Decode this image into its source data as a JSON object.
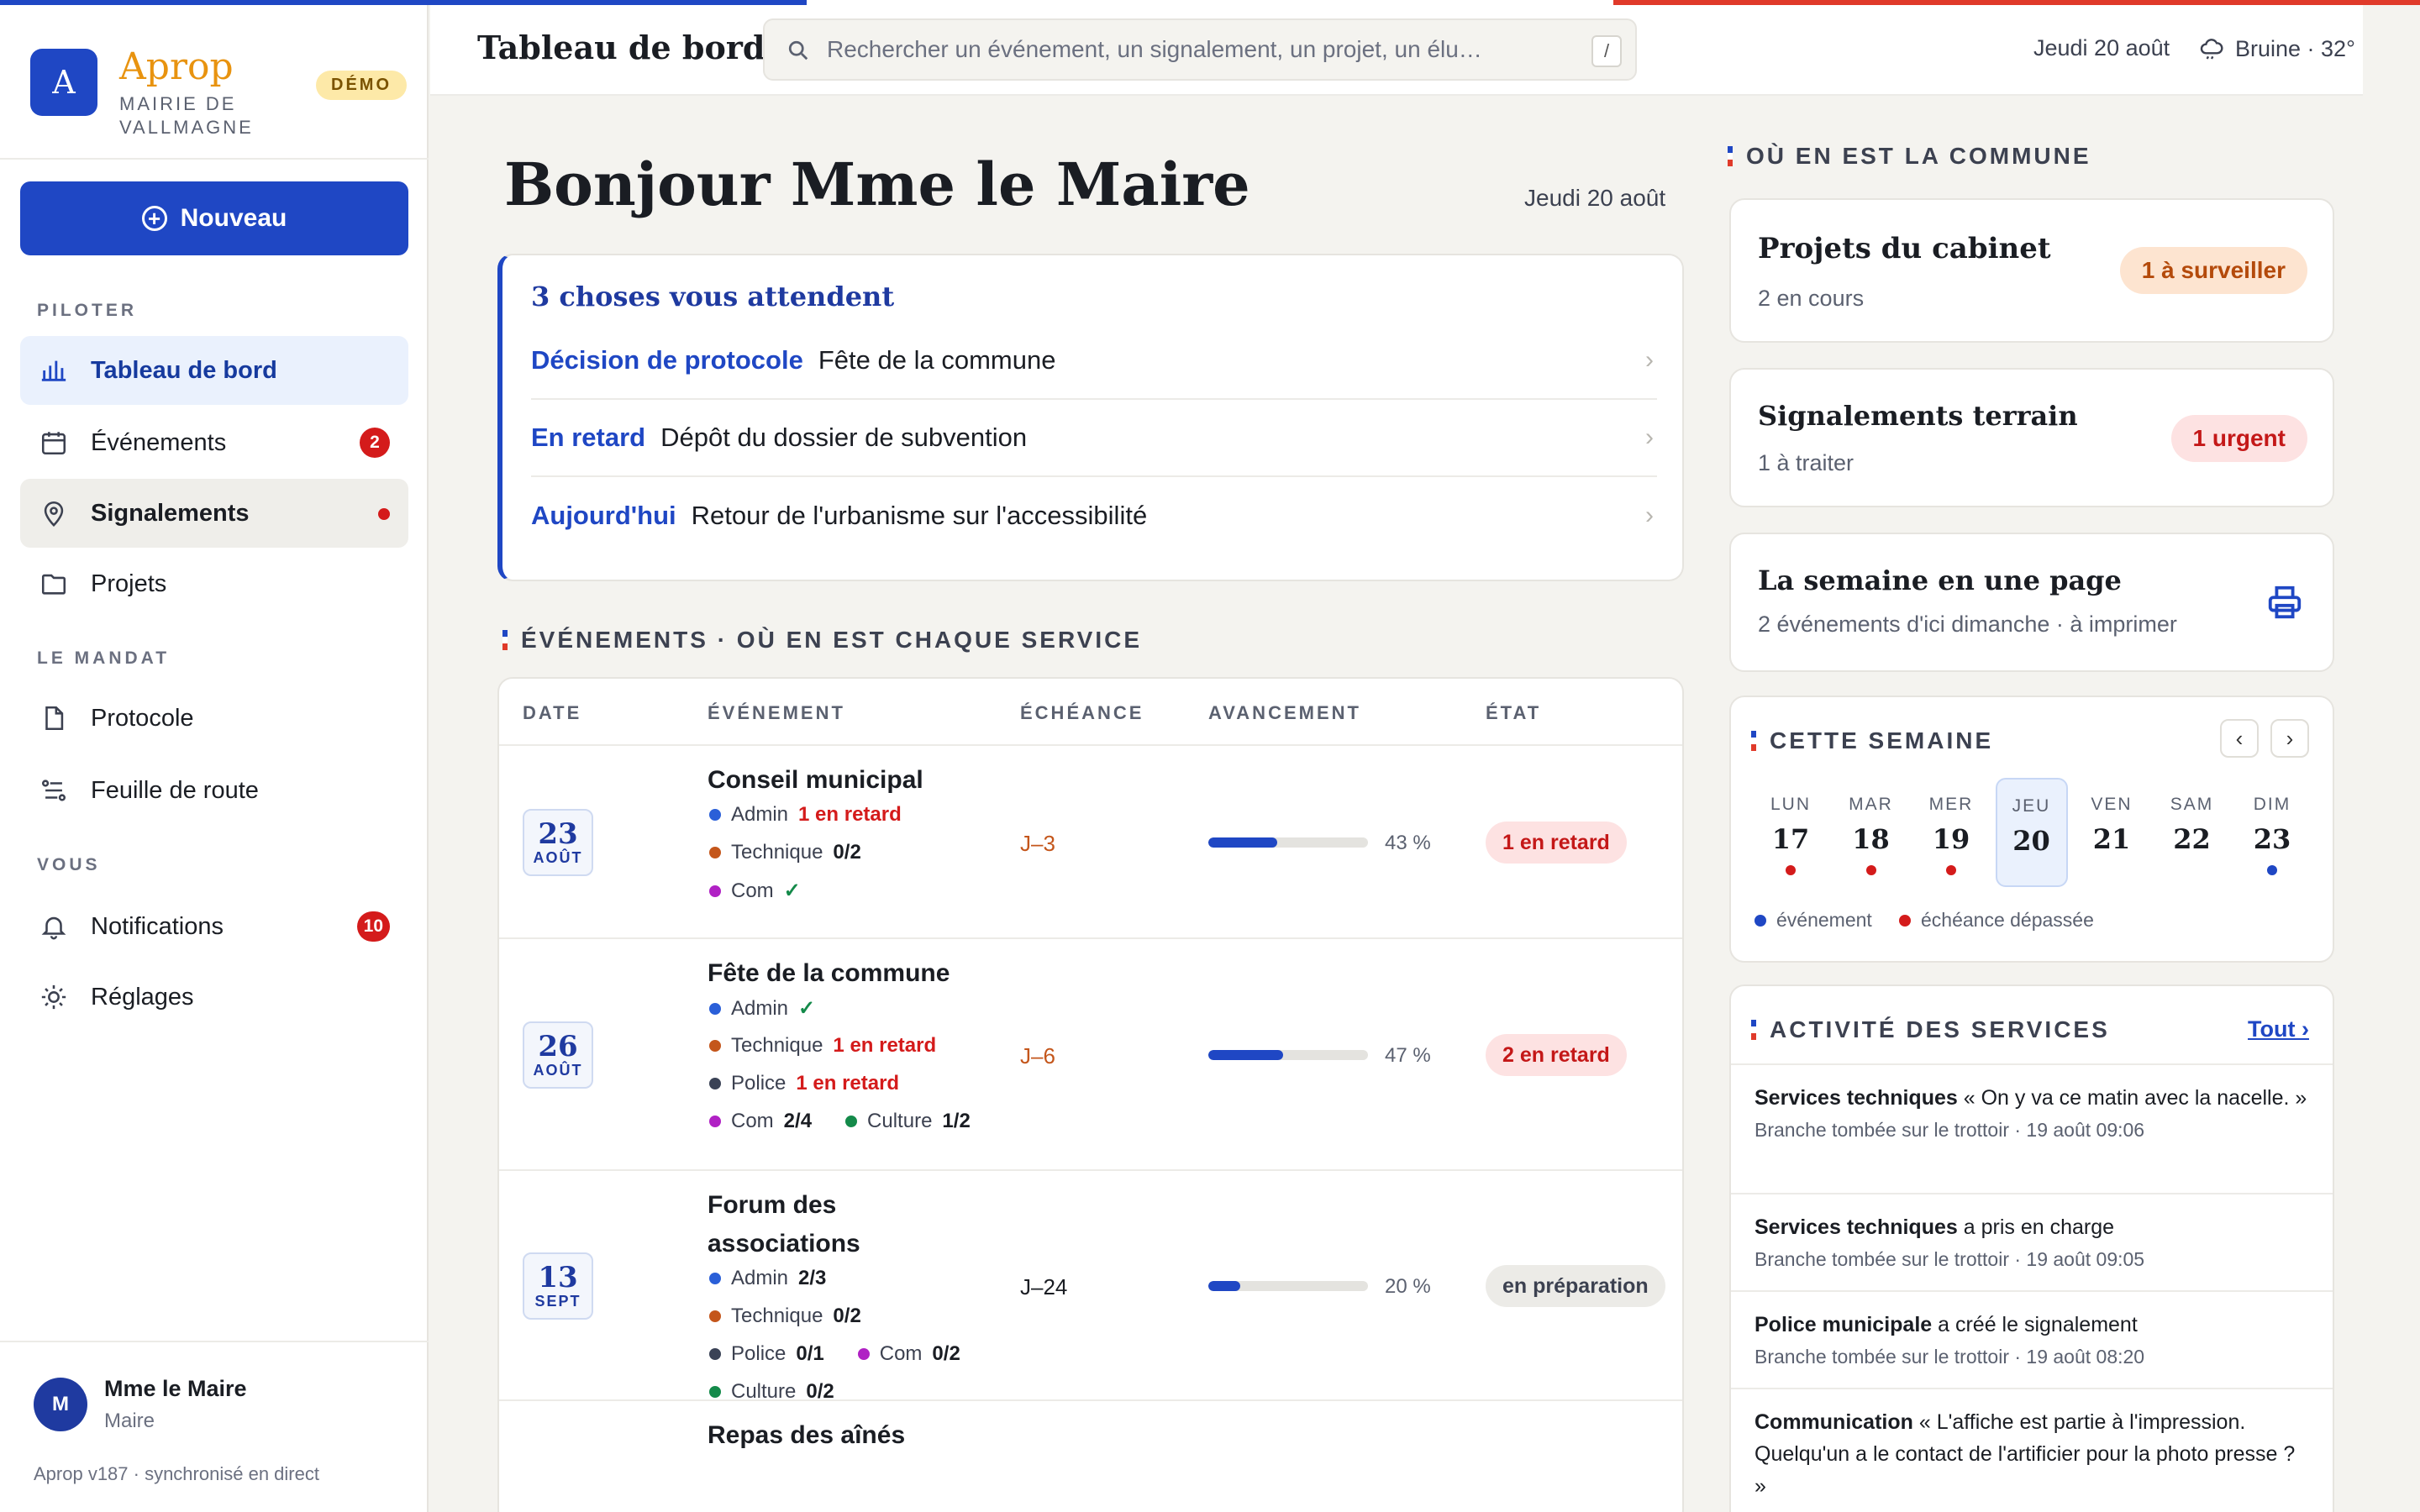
{
  "colors": {
    "accent": "#1f47c4",
    "brand_orange": "#e8930f",
    "danger": "#d41b1b",
    "flag_blue": "#1f47c4",
    "flag_white": "#ffffff",
    "flag_red": "#e03a2a"
  },
  "sidebar": {
    "logo_letter": "A",
    "app_name": "Aprop",
    "org_name": "MAIRIE DE VALLMAGNE",
    "demo_badge": "DÉMO",
    "new_button": "Nouveau",
    "sections": {
      "piloter": "PILOTER",
      "mandat": "LE MANDAT",
      "vous": "VOUS"
    },
    "items": [
      {
        "label": "Tableau de bord",
        "icon": "bar-chart-icon"
      },
      {
        "label": "Événements",
        "icon": "calendar-icon",
        "badge": "2"
      },
      {
        "label": "Signalements",
        "icon": "map-pin-icon",
        "dot": true
      },
      {
        "label": "Projets",
        "icon": "folder-icon"
      },
      {
        "label": "Protocole",
        "icon": "document-icon"
      },
      {
        "label": "Feuille de route",
        "icon": "route-icon"
      },
      {
        "label": "Notifications",
        "icon": "bell-icon",
        "badge": "10"
      },
      {
        "label": "Réglages",
        "icon": "sun-gear-icon"
      }
    ],
    "user": {
      "initial": "M",
      "name": "Mme le Maire",
      "role": "Maire"
    },
    "version": "Aprop v187 · synchronisé en direct"
  },
  "header": {
    "title": "Tableau de bord",
    "search_placeholder": "Rechercher un événement, un signalement, un projet, un élu…",
    "search_shortcut": "/",
    "date": "Jeudi 20 août",
    "weather": "Bruine · 32°"
  },
  "main": {
    "greeting": "Bonjour Mme le Maire",
    "date": "Jeudi 20 août",
    "todo": {
      "title": "3 choses vous attendent",
      "items": [
        {
          "tag": "Décision de protocole",
          "text": "Fête de la commune"
        },
        {
          "tag": "En retard",
          "text": "Dépôt du dossier de subvention"
        },
        {
          "tag": "Aujourd'hui",
          "text": "Retour de l'urbanisme sur l'accessibilité"
        }
      ]
    },
    "events_section": "ÉVÉNEMENTS · OÙ EN EST CHAQUE SERVICE",
    "events_columns": [
      "DATE",
      "ÉVÉNEMENT",
      "ÉCHÉANCE",
      "AVANCEMENT",
      "ÉTAT"
    ],
    "events": [
      {
        "day": "23",
        "month": "AOÛT",
        "name": "Conseil municipal",
        "due": "J–3",
        "progress": 43,
        "progress_label": "43 %",
        "state": "1 en retard",
        "services": [
          [
            {
              "n": "Admin",
              "v": "1 en retard",
              "s": "late",
              "c": "#2a5fd8"
            }
          ],
          [
            {
              "n": "Technique",
              "v": "0/2",
              "s": "",
              "c": "#c4561b"
            }
          ],
          [
            {
              "n": "Com",
              "v": "✓",
              "s": "ok",
              "c": "#b021c4"
            }
          ]
        ]
      },
      {
        "day": "26",
        "month": "AOÛT",
        "name": "Fête de la commune",
        "due": "J–6",
        "progress": 47,
        "progress_label": "47 %",
        "state": "2 en retard",
        "services": [
          [
            {
              "n": "Admin",
              "v": "✓",
              "s": "ok",
              "c": "#2a5fd8"
            }
          ],
          [
            {
              "n": "Technique",
              "v": "1 en retard",
              "s": "late",
              "c": "#c4561b"
            }
          ],
          [
            {
              "n": "Police",
              "v": "1 en retard",
              "s": "late",
              "c": "#3a4256"
            }
          ],
          [
            {
              "n": "Com",
              "v": "2/4",
              "s": "",
              "c": "#b021c4"
            },
            {
              "n": "Culture",
              "v": "1/2",
              "s": "",
              "c": "#148a4a"
            }
          ]
        ]
      },
      {
        "day": "13",
        "month": "SEPT",
        "name": "Forum des associations",
        "due": "J–24",
        "progress": 20,
        "progress_label": "20 %",
        "state": "en préparation",
        "services": [
          [
            {
              "n": "Admin",
              "v": "2/3",
              "s": "",
              "c": "#2a5fd8"
            }
          ],
          [
            {
              "n": "Technique",
              "v": "0/2",
              "s": "",
              "c": "#c4561b"
            }
          ],
          [
            {
              "n": "Police",
              "v": "0/1",
              "s": "",
              "c": "#3a4256"
            },
            {
              "n": "Com",
              "v": "0/2",
              "s": "",
              "c": "#b021c4"
            }
          ],
          [
            {
              "n": "Culture",
              "v": "0/2",
              "s": "",
              "c": "#148a4a"
            }
          ]
        ]
      },
      {
        "name": "Repas des aînés"
      }
    ]
  },
  "right": {
    "section": "OÙ EN EST LA COMMUNE",
    "projets": {
      "title": "Projets du cabinet",
      "sub": "2 en cours",
      "pill": "1 à surveiller"
    },
    "signalements": {
      "title": "Signalements terrain",
      "sub": "1 à traiter",
      "pill": "1 urgent"
    },
    "semaine": {
      "title": "La semaine en une page",
      "sub": "2 événements d'ici dimanche · à imprimer"
    },
    "week": {
      "title": "CETTE SEMAINE",
      "prev": "‹",
      "next": "›",
      "days": [
        {
          "n": "LUN",
          "d": "17",
          "dot": "red"
        },
        {
          "n": "MAR",
          "d": "18",
          "dot": "red"
        },
        {
          "n": "MER",
          "d": "19",
          "dot": "red"
        },
        {
          "n": "JEU",
          "d": "20",
          "dot": "",
          "today": true
        },
        {
          "n": "VEN",
          "d": "21",
          "dot": ""
        },
        {
          "n": "SAM",
          "d": "22",
          "dot": ""
        },
        {
          "n": "DIM",
          "d": "23",
          "dot": "blue"
        }
      ],
      "legend_event": "événement",
      "legend_late": "échéance dépassée"
    },
    "activity": {
      "title": "ACTIVITÉ DES SERVICES",
      "all": "Tout ›",
      "items": [
        {
          "who": "Services techniques",
          "what": " « On y va ce matin avec la nacelle. »",
          "meta": "Branche tombée sur le trottoir · 19 août 09:06"
        },
        {
          "who": "Services techniques",
          "what": " a pris en charge",
          "meta": "Branche tombée sur le trottoir · 19 août 09:05"
        },
        {
          "who": "Police municipale",
          "what": " a créé le signalement",
          "meta": "Branche tombée sur le trottoir · 19 août 08:20"
        },
        {
          "who": "Communication",
          "what": " « L'affiche est partie à l'impression. Quelqu'un a le contact de l'artificier pour la photo presse ? »",
          "meta": ""
        }
      ]
    }
  }
}
